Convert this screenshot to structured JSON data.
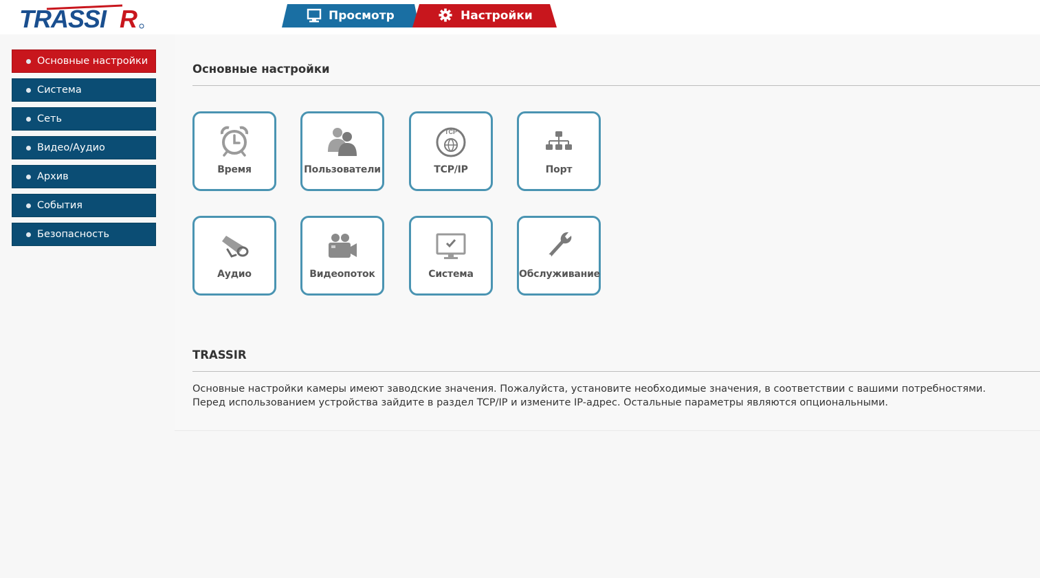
{
  "header": {
    "logo_text": "TRASSIR",
    "tabs": [
      {
        "label": "Просмотр",
        "icon": "monitor-icon",
        "color": "#1a6fa3"
      },
      {
        "label": "Настройки",
        "icon": "gear-icon",
        "color": "#c8161d"
      }
    ]
  },
  "sidebar": {
    "items": [
      {
        "label": "Основные настройки",
        "active": true
      },
      {
        "label": "Система"
      },
      {
        "label": "Сеть"
      },
      {
        "label": "Видео/Аудио"
      },
      {
        "label": "Архив"
      },
      {
        "label": "События"
      },
      {
        "label": "Безопасность"
      }
    ]
  },
  "main": {
    "title": "Основные настройки",
    "tiles": [
      {
        "label": "Время",
        "icon": "alarm-clock-icon"
      },
      {
        "label": "Пользователи",
        "icon": "users-icon"
      },
      {
        "label": "TCP/IP",
        "icon": "tcp-globe-icon",
        "icon_text": "TCP"
      },
      {
        "label": "Порт",
        "icon": "network-hierarchy-icon"
      },
      {
        "label": "Аудио",
        "icon": "megaphone-icon"
      },
      {
        "label": "Видеопоток",
        "icon": "video-camera-icon"
      },
      {
        "label": "Система",
        "icon": "monitor-check-icon"
      },
      {
        "label": "Обслуживание",
        "icon": "wrench-icon"
      }
    ],
    "info": {
      "title": "TRASSIR",
      "line1": "Основные настройки камеры имеют заводские значения. Пожалуйста, установите необходимые значения, в соответствии с вашими потребностями.",
      "line2": "Перед использованием устройства зайдите в раздел TCP/IP и измените IP-адрес. Остальные параметры являются опциональными."
    }
  },
  "colors": {
    "brand_blue": "#1a4f8f",
    "brand_red": "#c8161d",
    "sidebar_blue": "#0b4d74",
    "tile_border": "#4a94b2"
  }
}
